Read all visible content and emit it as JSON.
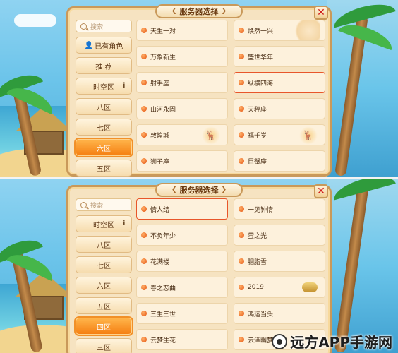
{
  "top": {
    "title": "服务器选择",
    "search_placeholder": "搜索",
    "sidebar": [
      "已有角色",
      "推  荐",
      "时空区",
      "八区",
      "七区",
      "六区",
      "五区"
    ],
    "active_index": 5,
    "servers": [
      {
        "name": "天生一对"
      },
      {
        "name": "焕然一兴"
      },
      {
        "name": "万象新生"
      },
      {
        "name": "盛世华年"
      },
      {
        "name": "射手座"
      },
      {
        "name": "纵横四海"
      },
      {
        "name": "山河永固"
      },
      {
        "name": "天秤座"
      },
      {
        "name": "敦煌城"
      },
      {
        "name": "福千岁"
      },
      {
        "name": "狮子座"
      },
      {
        "name": "巨蟹座"
      }
    ],
    "selected_index": 5
  },
  "bottom": {
    "title": "服务器选择",
    "search_placeholder": "搜索",
    "sidebar": [
      "时空区",
      "八区",
      "七区",
      "六区",
      "五区",
      "四区",
      "三区"
    ],
    "active_index": 5,
    "servers": [
      {
        "name": "情人结"
      },
      {
        "name": "一见钟情"
      },
      {
        "name": "不负年少"
      },
      {
        "name": "萤之光"
      },
      {
        "name": "花满楼"
      },
      {
        "name": "胭脂雪"
      },
      {
        "name": "春之恋曲"
      },
      {
        "name": "2019"
      },
      {
        "name": "三生三世"
      },
      {
        "name": "鸿运当头"
      },
      {
        "name": "云梦生花"
      },
      {
        "name": "云泽幽梦"
      }
    ],
    "selected_index": 0
  },
  "watermark": "远方APP手游网",
  "icons": {
    "close": "close-icon",
    "search": "search-icon",
    "server_dot": "fire-dot-icon",
    "deer": "deer-icon"
  },
  "colors": {
    "accent": "#f57f12",
    "border": "#c9995a",
    "close": "#d11d1d",
    "selected_border": "#e8562a"
  }
}
